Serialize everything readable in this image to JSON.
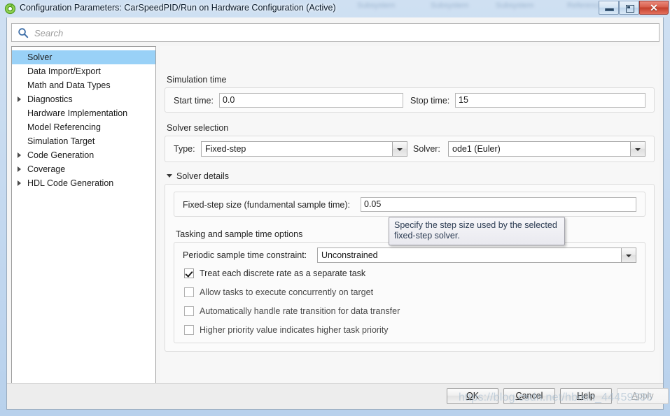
{
  "window": {
    "title": "Configuration Parameters: CarSpeedPID/Run on Hardware Configuration (Active)",
    "app_icon": "simulink-icon",
    "controls": {
      "minimize": "minimize-icon",
      "maximize": "restore-icon",
      "close": "close-icon"
    },
    "background_bleed": [
      "Subsystem",
      "Subsystem",
      "Subsystem",
      "Reference"
    ]
  },
  "search": {
    "placeholder": "Search",
    "value": "",
    "icon": "search-icon"
  },
  "sidebar": {
    "items": [
      {
        "label": "Solver",
        "selected": true,
        "expandable": false
      },
      {
        "label": "Data Import/Export",
        "selected": false,
        "expandable": false
      },
      {
        "label": "Math and Data Types",
        "selected": false,
        "expandable": false
      },
      {
        "label": "Diagnostics",
        "selected": false,
        "expandable": true
      },
      {
        "label": "Hardware Implementation",
        "selected": false,
        "expandable": false
      },
      {
        "label": "Model Referencing",
        "selected": false,
        "expandable": false
      },
      {
        "label": "Simulation Target",
        "selected": false,
        "expandable": false
      },
      {
        "label": "Code Generation",
        "selected": false,
        "expandable": true
      },
      {
        "label": "Coverage",
        "selected": false,
        "expandable": true
      },
      {
        "label": "HDL Code Generation",
        "selected": false,
        "expandable": true
      }
    ]
  },
  "content": {
    "simulation_time": {
      "section_label": "Simulation time",
      "start_time_label": "Start time:",
      "start_time_value": "0.0",
      "stop_time_label": "Stop time:",
      "stop_time_value": "15"
    },
    "solver_selection": {
      "section_label": "Solver selection",
      "type_label": "Type:",
      "type_value": "Fixed-step",
      "solver_label": "Solver:",
      "solver_value": "ode1 (Euler)"
    },
    "solver_details": {
      "section_label": "Solver details",
      "expanded": true,
      "fixed_step_label": "Fixed-step size (fundamental sample time):",
      "fixed_step_value": "0.05",
      "tasking_label": "Tasking and sample time options",
      "periodic_label": "Periodic sample time constraint:",
      "periodic_value": "Unconstrained",
      "checkboxes": [
        {
          "label": "Treat each discrete rate as a separate task",
          "checked": true,
          "dim": false
        },
        {
          "label": "Allow tasks to execute concurrently on target",
          "checked": false,
          "dim": true
        },
        {
          "label": "Automatically handle rate transition for data transfer",
          "checked": false,
          "dim": true
        },
        {
          "label": "Higher priority value indicates higher task priority",
          "checked": false,
          "dim": true
        }
      ]
    }
  },
  "tooltip": {
    "text": "Specify the step size used by the selected fixed-step solver."
  },
  "footer": {
    "buttons": [
      {
        "label": "OK",
        "mnemonic": "O",
        "disabled": false
      },
      {
        "label": "Cancel",
        "mnemonic": "C",
        "disabled": false
      },
      {
        "label": "Help",
        "mnemonic": "H",
        "disabled": false
      },
      {
        "label": "Apply",
        "mnemonic": "A",
        "disabled": true
      }
    ]
  },
  "watermark": {
    "text": "https://blog.csdn.net/hbixin_44459386"
  },
  "colors": {
    "selection_blue": "#99d1f7",
    "titlebar_blue": "#c3d8ef",
    "close_red": "#c23f2c",
    "search_icon_blue": "#3f6fa8"
  }
}
